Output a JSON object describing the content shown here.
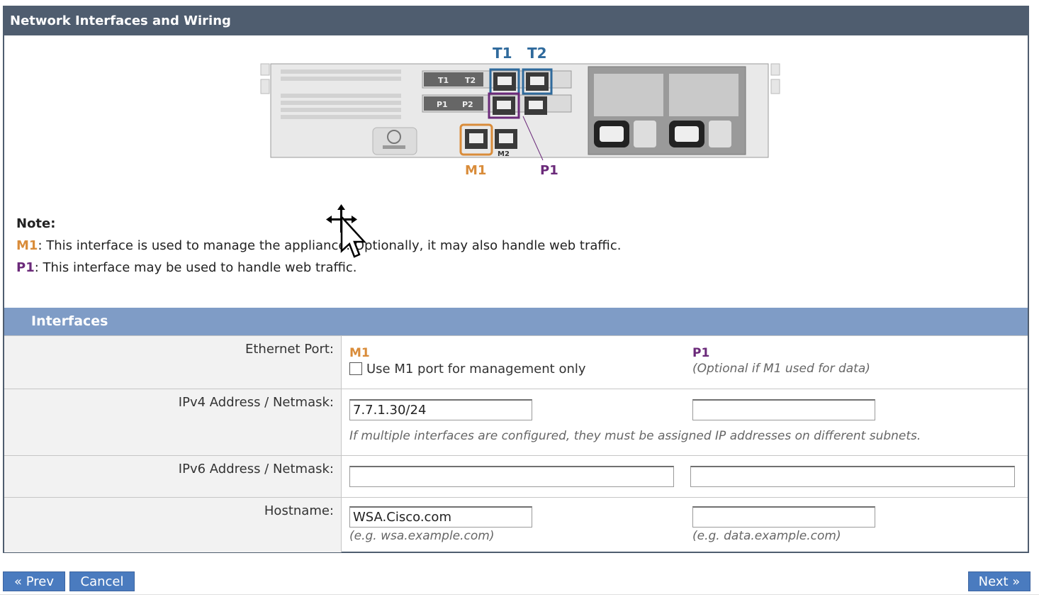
{
  "panel": {
    "title": "Network Interfaces and Wiring"
  },
  "diagram": {
    "t1": "T1",
    "t2": "T2",
    "p1": "P1",
    "p2": "P2",
    "m1": "M1",
    "m2": "M2",
    "colors": {
      "t": "#2f6a9c",
      "p": "#6b2a7a",
      "m": "#d98c3a"
    }
  },
  "note": {
    "label": "Note:",
    "m1_tag": "M1",
    "m1_text": ": This interface is used to manage the appliance. Optionally, it may also handle web traffic.",
    "p1_tag": "P1",
    "p1_text": ": This interface may be used to handle web traffic."
  },
  "interfaces": {
    "title": "Interfaces",
    "ethernet_label": "Ethernet Port:",
    "m1_header": "M1",
    "m1_checkbox_label": "Use M1 port for management only",
    "p1_header": "P1",
    "p1_hint": "(Optional if M1 used for data)",
    "ipv4_label": "IPv4 Address / Netmask:",
    "ipv4_m1": "7.7.1.30/24",
    "ipv4_p1": "",
    "ipv4_hint": "If multiple interfaces are configured, they must be assigned IP addresses on different subnets.",
    "ipv6_label": "IPv6 Address / Netmask:",
    "ipv6_m1": "",
    "ipv6_p1": "",
    "hostname_label": "Hostname:",
    "hostname_m1": "WSA.Cisco.com",
    "hostname_m1_hint": "(e.g. wsa.example.com)",
    "hostname_p1": "",
    "hostname_p1_hint": "(e.g. data.example.com)"
  },
  "buttons": {
    "prev": "« Prev",
    "cancel": "Cancel",
    "next": "Next »"
  }
}
